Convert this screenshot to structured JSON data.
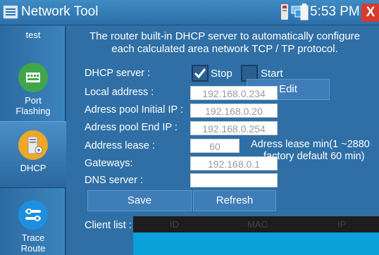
{
  "window": {
    "title": "Network Tool",
    "time": "5:53 PM",
    "close_label": "X"
  },
  "sidebar": {
    "top_label": "test",
    "items": [
      {
        "label_line1": "Port",
        "label_line2": "Flashing",
        "icon": "port-flashing-icon",
        "color": "#3fa74a"
      },
      {
        "label_line1": "DHCP",
        "label_line2": "",
        "icon": "dhcp-icon",
        "color": "#f0a824"
      },
      {
        "label_line1": "Trace",
        "label_line2": "Route",
        "icon": "trace-route-icon",
        "color": "#1e8fe0"
      }
    ]
  },
  "main": {
    "description_line1": "The router built-in DHCP server to automatically configure",
    "description_line2": "each calculated area network TCP / TP protocol.",
    "dhcp_server_label": "DHCP server :",
    "stop_label": "Stop",
    "start_label": "Start",
    "stop_checked": true,
    "start_checked": false,
    "edit_label": "Edit",
    "local_address_label": "Local address :",
    "local_address_value": "192.168.0.234",
    "pool_initial_label": "Adress pool Initial IP :",
    "pool_initial_value": "192.168.0.20",
    "pool_end_label": "Adress pool End IP :",
    "pool_end_value": "192.168.0.254",
    "lease_label": "Address lease :",
    "lease_value": "60",
    "lease_note_line1": "Adress lease min(1 ~2880",
    "lease_note_line2": "factory default 60 min)",
    "gateways_label": "Gateways:",
    "gateways_value": "192.168.0.1",
    "dns_label": "DNS server :",
    "dns_value": "",
    "save_label": "Save",
    "refresh_label": "Refresh",
    "client_list_label": "Client list :",
    "client_columns": [
      "ID",
      "MAC",
      "IP"
    ]
  }
}
